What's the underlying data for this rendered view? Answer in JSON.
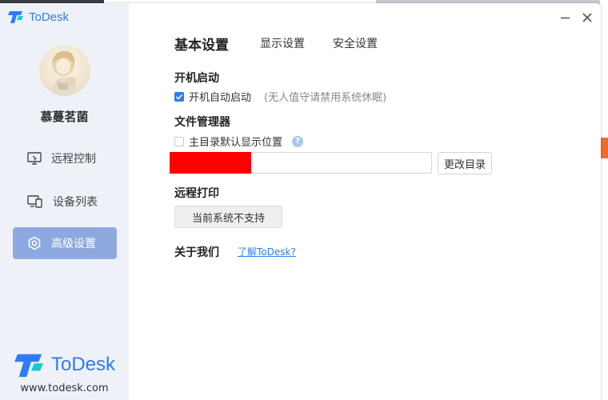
{
  "app": {
    "title": "ToDesk"
  },
  "user": {
    "name": "慕蔓茗菌"
  },
  "sidebar": {
    "items": [
      {
        "label": "远程控制",
        "icon": "monitor-icon"
      },
      {
        "label": "设备列表",
        "icon": "devices-icon"
      },
      {
        "label": "高级设置",
        "icon": "settings-icon",
        "active": true
      }
    ]
  },
  "footer": {
    "brand": "ToDesk",
    "url": "www.todesk.com"
  },
  "tabs": [
    {
      "label": "基本设置",
      "active": true
    },
    {
      "label": "显示设置"
    },
    {
      "label": "安全设置"
    }
  ],
  "startup": {
    "title": "开机启动",
    "checkbox_label": "开机自动启动",
    "checked": true,
    "hint": "(无人值守请禁用系统休眠)"
  },
  "file_manager": {
    "title": "文件管理器",
    "checkbox_label": "主目录默认显示位置",
    "checked": false,
    "path_value": "",
    "change_button": "更改目录"
  },
  "remote_print": {
    "title": "远程打印",
    "status_button": "当前系统不支持"
  },
  "about": {
    "title": "关于我们",
    "link": "了解ToDesk?"
  },
  "colors": {
    "brand": "#2c7cf6",
    "sidebar_bg": "#eef2f8",
    "active_nav": "#8ea9e0",
    "redaction": "#ff0000"
  }
}
